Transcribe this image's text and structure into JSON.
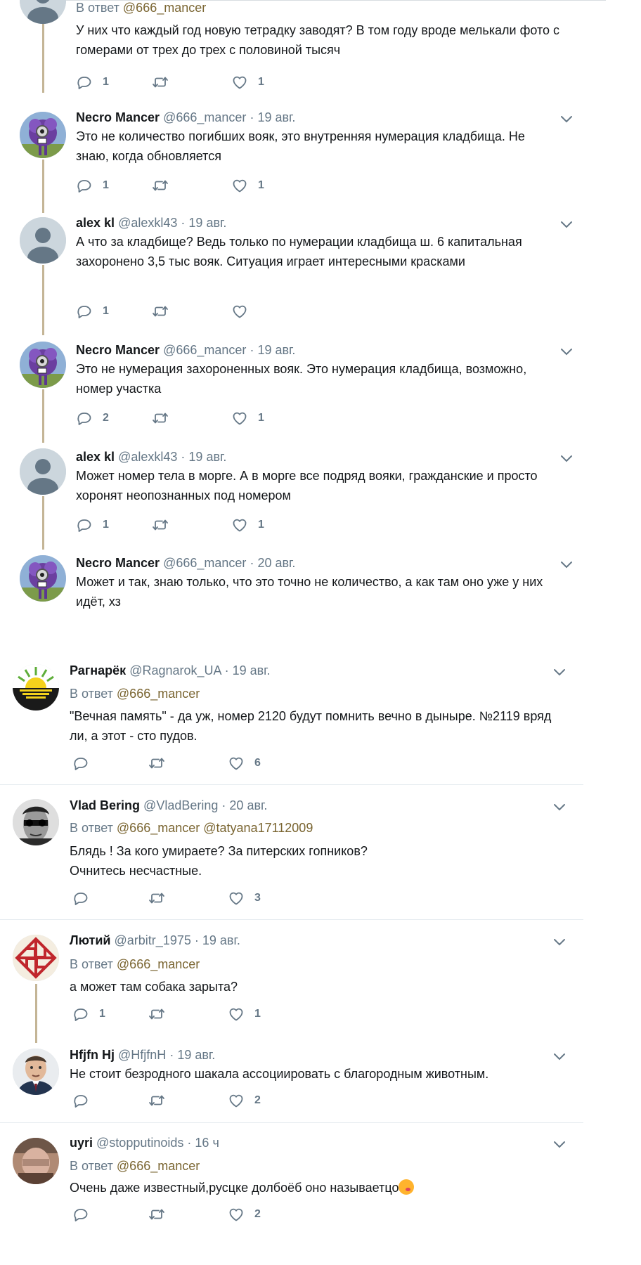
{
  "reply_prefix": "В ответ",
  "thread": [
    {
      "name": "",
      "handle": "",
      "date": "",
      "reply_to": "@666_mancer",
      "text": "У них что каждый год новую тетрадку заводят? В том году вроде мелькали фото с гомерами от трех до трех с половиной тысяч",
      "replies": "1",
      "retweets": "",
      "likes": "1",
      "avatar": "default-avatar"
    },
    {
      "name": "Necro Mancer",
      "handle": "@666_mancer",
      "date": "19 авг.",
      "text": "Это не количество погибших вояк, это внутренняя нумерация кладбища. Не знаю, когда обновляется",
      "replies": "1",
      "retweets": "",
      "likes": "1",
      "avatar": "purple-monster-avatar"
    },
    {
      "name": "alex kl",
      "handle": "@alexkl43",
      "date": "19 авг.",
      "text": "А что за кладбище? Ведь только по нумерации кладбища ш. 6 капитальная захоронено 3,5 тыс вояк. Ситуация играет интересными красками",
      "replies": "1",
      "retweets": "",
      "likes": "",
      "avatar": "default-avatar"
    },
    {
      "name": "Necro Mancer",
      "handle": "@666_mancer",
      "date": "19 авг.",
      "text": "Это не нумерация захороненных вояк. Это нумерация кладбища, возможно, номер участка",
      "replies": "2",
      "retweets": "",
      "likes": "1",
      "avatar": "purple-monster-avatar"
    },
    {
      "name": "alex kl",
      "handle": "@alexkl43",
      "date": "19 авг.",
      "text": "Может номер тела в морге. А в морге все подряд вояки, гражданские и просто хоронят неопознанных под номером",
      "replies": "1",
      "retweets": "",
      "likes": "1",
      "avatar": "default-avatar"
    },
    {
      "name": "Necro Mancer",
      "handle": "@666_mancer",
      "date": "20 авг.",
      "text": "Может и так, знаю только, что это точно не количество, а как там оно уже у них идёт, хз",
      "replies": "",
      "retweets": "",
      "likes": "",
      "avatar": "purple-monster-avatar"
    }
  ],
  "tweets": [
    {
      "name": "Рагнарёк",
      "handle": "@Ragnarok_UA",
      "date": "19 авг.",
      "reply_to": "@666_mancer",
      "reply_to2": "",
      "text": "\"Вечная память\" - да уж, номер 2120 будут помнить вечно в дыныре. №2119 вряд ли, а этот - сто пудов.",
      "replies": "",
      "retweets": "",
      "likes": "6",
      "avatar": "sun-emblem-avatar"
    },
    {
      "name": "Vlad Bering",
      "handle": "@VladBering",
      "date": "20 авг.",
      "reply_to": "@666_mancer",
      "reply_to2": "@tatyana17112009",
      "text": "Блядь ! За кого умираете? За питерских гопников?\nОчнитесь несчастные.",
      "replies": "",
      "retweets": "",
      "likes": "3",
      "avatar": "bw-face-avatar"
    },
    {
      "name": "Лютий",
      "handle": "@arbitr_1975",
      "date": "19 авг.",
      "reply_to": "@666_mancer",
      "reply_to2": "",
      "text": "а может там собака зарыта?",
      "replies": "1",
      "retweets": "",
      "likes": "1",
      "avatar": "red-ornament-avatar"
    },
    {
      "name": "Hfjfn Hj",
      "handle": "@HfjfnH",
      "date": "19 авг.",
      "reply_to": "",
      "reply_to2": "",
      "text": "Не стоит безродного шакала ассоциировать с благородным животным.",
      "replies": "",
      "retweets": "",
      "likes": "2",
      "avatar": "man-portrait-avatar"
    },
    {
      "name": "uyri",
      "handle": "@stopputinoids",
      "date": "16 ч",
      "reply_to": "@666_mancer",
      "reply_to2": "",
      "text": "Очень даже известный,русцке долбоёб оно называетцо",
      "emoji": "kissing-face-emoji",
      "replies": "",
      "retweets": "",
      "likes": "2",
      "avatar": "photo-avatar"
    }
  ]
}
